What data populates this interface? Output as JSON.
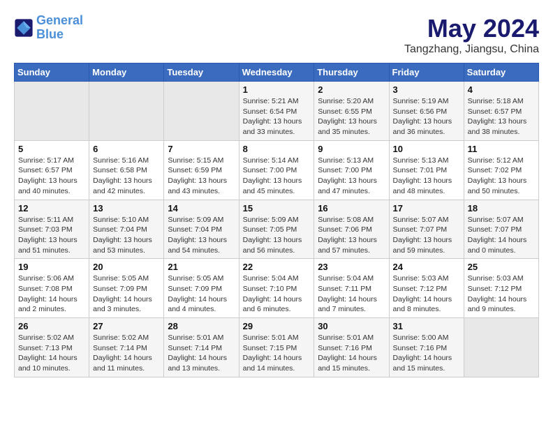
{
  "logo": {
    "line1": "General",
    "line2": "Blue"
  },
  "title": "May 2024",
  "location": "Tangzhang, Jiangsu, China",
  "days_of_week": [
    "Sunday",
    "Monday",
    "Tuesday",
    "Wednesday",
    "Thursday",
    "Friday",
    "Saturday"
  ],
  "weeks": [
    [
      {
        "day": "",
        "detail": ""
      },
      {
        "day": "",
        "detail": ""
      },
      {
        "day": "",
        "detail": ""
      },
      {
        "day": "1",
        "detail": "Sunrise: 5:21 AM\nSunset: 6:54 PM\nDaylight: 13 hours\nand 33 minutes."
      },
      {
        "day": "2",
        "detail": "Sunrise: 5:20 AM\nSunset: 6:55 PM\nDaylight: 13 hours\nand 35 minutes."
      },
      {
        "day": "3",
        "detail": "Sunrise: 5:19 AM\nSunset: 6:56 PM\nDaylight: 13 hours\nand 36 minutes."
      },
      {
        "day": "4",
        "detail": "Sunrise: 5:18 AM\nSunset: 6:57 PM\nDaylight: 13 hours\nand 38 minutes."
      }
    ],
    [
      {
        "day": "5",
        "detail": "Sunrise: 5:17 AM\nSunset: 6:57 PM\nDaylight: 13 hours\nand 40 minutes."
      },
      {
        "day": "6",
        "detail": "Sunrise: 5:16 AM\nSunset: 6:58 PM\nDaylight: 13 hours\nand 42 minutes."
      },
      {
        "day": "7",
        "detail": "Sunrise: 5:15 AM\nSunset: 6:59 PM\nDaylight: 13 hours\nand 43 minutes."
      },
      {
        "day": "8",
        "detail": "Sunrise: 5:14 AM\nSunset: 7:00 PM\nDaylight: 13 hours\nand 45 minutes."
      },
      {
        "day": "9",
        "detail": "Sunrise: 5:13 AM\nSunset: 7:00 PM\nDaylight: 13 hours\nand 47 minutes."
      },
      {
        "day": "10",
        "detail": "Sunrise: 5:13 AM\nSunset: 7:01 PM\nDaylight: 13 hours\nand 48 minutes."
      },
      {
        "day": "11",
        "detail": "Sunrise: 5:12 AM\nSunset: 7:02 PM\nDaylight: 13 hours\nand 50 minutes."
      }
    ],
    [
      {
        "day": "12",
        "detail": "Sunrise: 5:11 AM\nSunset: 7:03 PM\nDaylight: 13 hours\nand 51 minutes."
      },
      {
        "day": "13",
        "detail": "Sunrise: 5:10 AM\nSunset: 7:04 PM\nDaylight: 13 hours\nand 53 minutes."
      },
      {
        "day": "14",
        "detail": "Sunrise: 5:09 AM\nSunset: 7:04 PM\nDaylight: 13 hours\nand 54 minutes."
      },
      {
        "day": "15",
        "detail": "Sunrise: 5:09 AM\nSunset: 7:05 PM\nDaylight: 13 hours\nand 56 minutes."
      },
      {
        "day": "16",
        "detail": "Sunrise: 5:08 AM\nSunset: 7:06 PM\nDaylight: 13 hours\nand 57 minutes."
      },
      {
        "day": "17",
        "detail": "Sunrise: 5:07 AM\nSunset: 7:07 PM\nDaylight: 13 hours\nand 59 minutes."
      },
      {
        "day": "18",
        "detail": "Sunrise: 5:07 AM\nSunset: 7:07 PM\nDaylight: 14 hours\nand 0 minutes."
      }
    ],
    [
      {
        "day": "19",
        "detail": "Sunrise: 5:06 AM\nSunset: 7:08 PM\nDaylight: 14 hours\nand 2 minutes."
      },
      {
        "day": "20",
        "detail": "Sunrise: 5:05 AM\nSunset: 7:09 PM\nDaylight: 14 hours\nand 3 minutes."
      },
      {
        "day": "21",
        "detail": "Sunrise: 5:05 AM\nSunset: 7:09 PM\nDaylight: 14 hours\nand 4 minutes."
      },
      {
        "day": "22",
        "detail": "Sunrise: 5:04 AM\nSunset: 7:10 PM\nDaylight: 14 hours\nand 6 minutes."
      },
      {
        "day": "23",
        "detail": "Sunrise: 5:04 AM\nSunset: 7:11 PM\nDaylight: 14 hours\nand 7 minutes."
      },
      {
        "day": "24",
        "detail": "Sunrise: 5:03 AM\nSunset: 7:12 PM\nDaylight: 14 hours\nand 8 minutes."
      },
      {
        "day": "25",
        "detail": "Sunrise: 5:03 AM\nSunset: 7:12 PM\nDaylight: 14 hours\nand 9 minutes."
      }
    ],
    [
      {
        "day": "26",
        "detail": "Sunrise: 5:02 AM\nSunset: 7:13 PM\nDaylight: 14 hours\nand 10 minutes."
      },
      {
        "day": "27",
        "detail": "Sunrise: 5:02 AM\nSunset: 7:14 PM\nDaylight: 14 hours\nand 11 minutes."
      },
      {
        "day": "28",
        "detail": "Sunrise: 5:01 AM\nSunset: 7:14 PM\nDaylight: 14 hours\nand 13 minutes."
      },
      {
        "day": "29",
        "detail": "Sunrise: 5:01 AM\nSunset: 7:15 PM\nDaylight: 14 hours\nand 14 minutes."
      },
      {
        "day": "30",
        "detail": "Sunrise: 5:01 AM\nSunset: 7:16 PM\nDaylight: 14 hours\nand 15 minutes."
      },
      {
        "day": "31",
        "detail": "Sunrise: 5:00 AM\nSunset: 7:16 PM\nDaylight: 14 hours\nand 15 minutes."
      },
      {
        "day": "",
        "detail": ""
      }
    ]
  ]
}
